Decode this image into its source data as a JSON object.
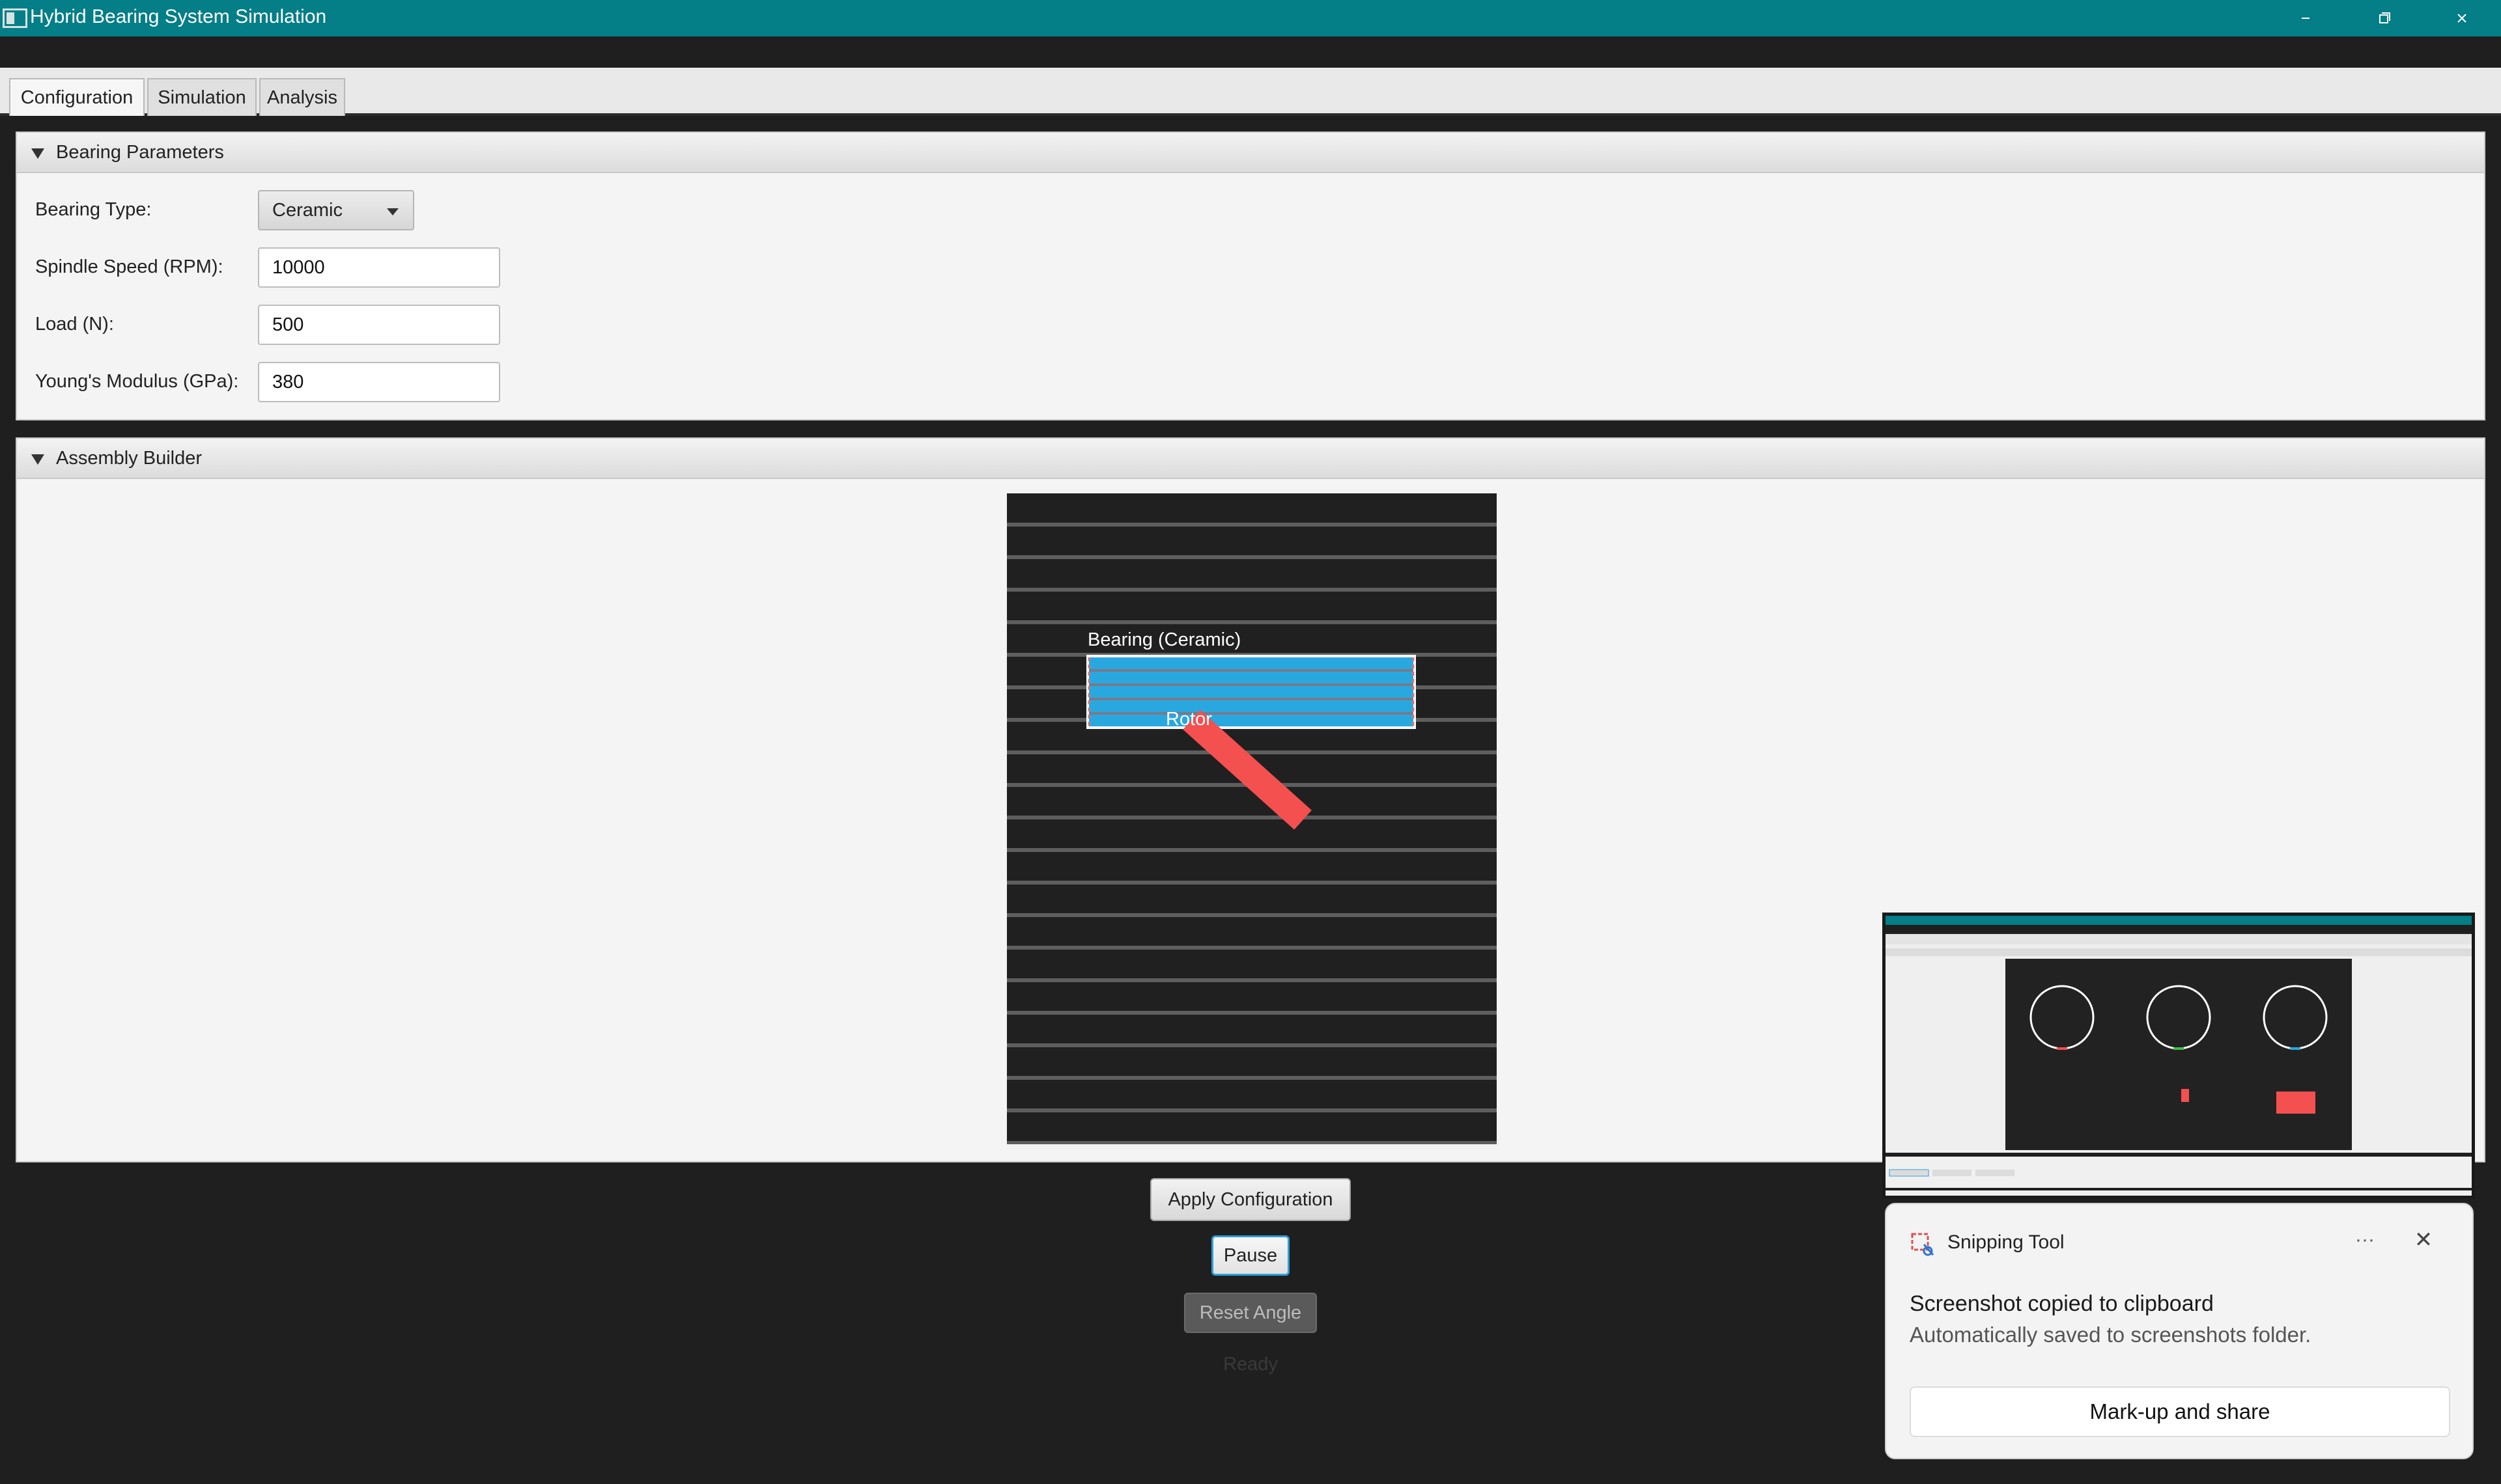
{
  "window": {
    "title": "Hybrid Bearing System Simulation",
    "accent_color": "#047e87",
    "controls": {
      "minimize_icon": "minimize-icon",
      "maximize_icon": "restore-icon",
      "close_icon": "close-icon"
    }
  },
  "tabs": [
    {
      "label": "Configuration",
      "active": true
    },
    {
      "label": "Simulation",
      "active": false
    },
    {
      "label": "Analysis",
      "active": false
    }
  ],
  "bearing_panel": {
    "title": "Bearing Parameters",
    "fields": {
      "bearing_type": {
        "label": "Bearing Type:",
        "value": "Ceramic"
      },
      "spindle_speed": {
        "label": "Spindle Speed (RPM):",
        "value": "10000"
      },
      "load": {
        "label": "Load (N):",
        "value": "500"
      },
      "youngs_modulus": {
        "label": "Young's Modulus (GPa):",
        "value": "380"
      }
    }
  },
  "assembly_panel": {
    "title": "Assembly Builder",
    "canvas": {
      "bearing_label": "Bearing (Ceramic)",
      "rotor_label": "Rotor",
      "bearing_color": "#29a8e0",
      "rotor_color": "#f45050",
      "background_color": "#202020"
    }
  },
  "actions": {
    "apply_label": "Apply Configuration",
    "pause_label": "Pause",
    "reset_label": "Reset Angle",
    "status": "Ready"
  },
  "notification": {
    "app_name": "Snipping Tool",
    "title": "Screenshot copied to clipboard",
    "body": "Automatically saved to screenshots folder.",
    "button_label": "Mark-up and share",
    "more_icon": "more-icon",
    "close_icon": "close-icon"
  }
}
